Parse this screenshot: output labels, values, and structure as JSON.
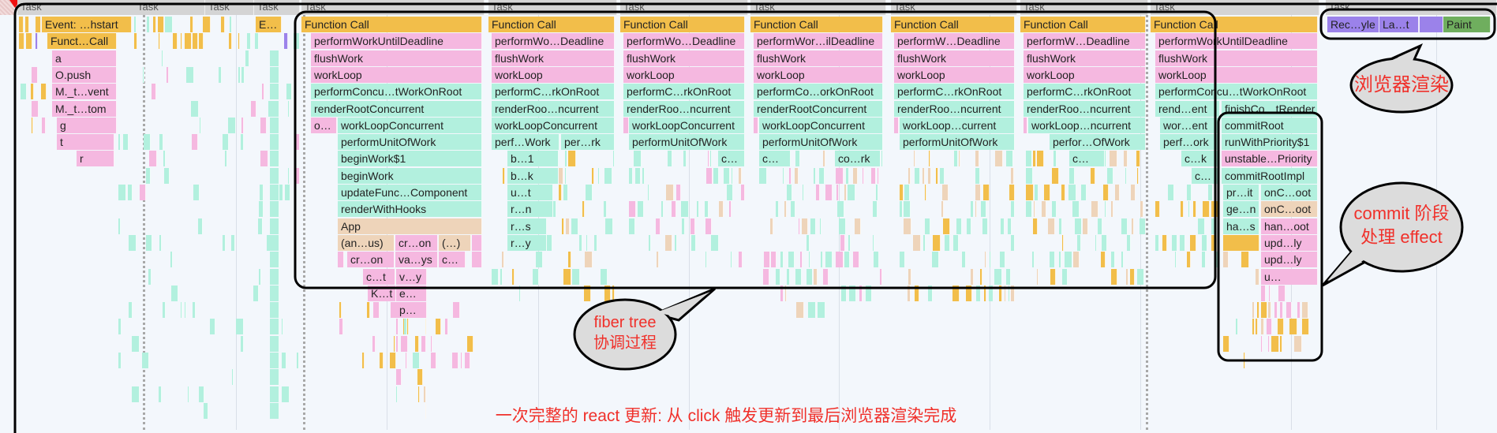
{
  "colors": {
    "orange": "#F2BE4A",
    "pink": "#F5B8E0",
    "teal": "#B2F0DE",
    "tan": "#EED4BA",
    "purple": "#9B82EA",
    "green": "#6FAE5E",
    "annotation": "#F0302A"
  },
  "task_label": "Task",
  "flame": {
    "L": [
      "Event: …hstart",
      "Funct…Call",
      "a",
      "O.push",
      "M._t…vent",
      "M._t…tom",
      "g",
      "t",
      "r",
      "E…"
    ],
    "A": [
      "Function Call",
      "performWorkUntilDeadline",
      "flushWork",
      "workLoop",
      "performConcu…tWorkOnRoot",
      "renderRootConcurrent",
      "o…",
      "workLoopConcurrent",
      "performUnitOfWork",
      "beginWork$1",
      "beginWork",
      "updateFunc…Component",
      "renderWithHooks",
      "App",
      "(an…us)",
      "cr…on",
      "(…)",
      "cr…on",
      "va…ys",
      "c…",
      "c…t",
      "v…y",
      "K…t",
      "e…",
      "p…"
    ],
    "B": [
      "Function Call",
      "performWo…Deadline",
      "flushWork",
      "workLoop",
      "performC…rkOnRoot",
      "renderRoo…ncurrent",
      "workLoopConcurrent",
      "perf…Work",
      "per…rk",
      "b…1",
      "b…k",
      "u…t",
      "r…n",
      "r…s",
      "r…y"
    ],
    "C": [
      "Function Call",
      "performWo…Deadline",
      "flushWork",
      "workLoop",
      "performC…rkOnRoot",
      "renderRoo…ncurrent",
      "workLoopConcurrent",
      "performUnitOfWork",
      "c…"
    ],
    "D": [
      "Function Call",
      "performWor…ilDeadline",
      "flushWork",
      "workLoop",
      "performCo…orkOnRoot",
      "renderRootConcurrent",
      "workLoopConcurrent",
      "performUnitOfWork",
      "c…",
      "co…rk"
    ],
    "E": [
      "Function Call",
      "performW…Deadline",
      "flushWork",
      "workLoop",
      "performC…rkOnRoot",
      "renderRoo…ncurrent",
      "workLoop…current",
      "performUnitOfWork"
    ],
    "F": [
      "Function Call",
      "performW…Deadline",
      "flushWork",
      "workLoop",
      "performC…rkOnRoot",
      "renderRoo…ncurrent",
      "workLoop…ncurrent",
      "perfor…OfWork",
      "c…"
    ],
    "G": [
      "Function Call",
      "performWorkUntilDeadline",
      "flushWork",
      "workLoop",
      "performConcu…tWorkOnRoot",
      "rend…ent",
      "finishCo…tRender",
      "wor…ent",
      "commitRoot",
      "perf…ork",
      "runWithPriority$1",
      "c…k",
      "unstable…Priority",
      "c…",
      "commitRootImpl",
      "pr…it",
      "onC…oot",
      "ge…n",
      "onC…oot",
      "ha…s",
      "han…oot",
      "upd…ly",
      "upd…ly",
      "u…"
    ],
    "R": [
      "Rec…yle",
      "La…t",
      "Paint"
    ]
  },
  "annotations": {
    "render_bubble": "浏览器渲染",
    "commit_bubble_line1": "commit 阶段",
    "commit_bubble_line2": "处理 effect",
    "fiber_bubble_line1": "fiber tree",
    "fiber_bubble_line2": "协调过程",
    "caption": "一次完整的 react 更新: 从 click 触发更新到最后浏览器渲染完成"
  }
}
